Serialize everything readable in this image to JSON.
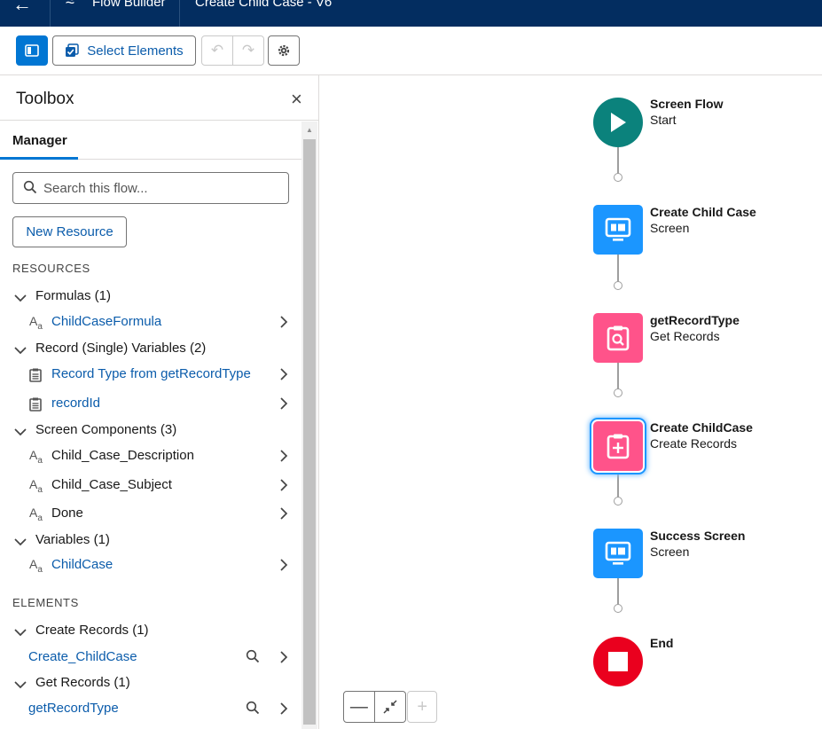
{
  "header": {
    "app_name": "Flow Builder",
    "flow_name": "Create Child Case - V6"
  },
  "toolbar": {
    "select_elements_label": "Select Elements"
  },
  "toolbox": {
    "title": "Toolbox",
    "tab_manager": "Manager",
    "search_placeholder": "Search this flow...",
    "new_resource_label": "New Resource",
    "resources_label": "RESOURCES",
    "elements_label": "ELEMENTS",
    "groups": {
      "formulas": "Formulas (1)",
      "record_single": "Record (Single) Variables (2)",
      "screen_components": "Screen Components (3)",
      "variables": "Variables (1)",
      "create_records": "Create Records (1)",
      "get_records": "Get Records (1)"
    },
    "items": {
      "child_case_formula": "ChildCaseFormula",
      "record_type_from": "Record Type from getRecordType",
      "record_id": "recordId",
      "child_case_description": "Child_Case_Description",
      "child_case_subject": "Child_Case_Subject",
      "done": "Done",
      "child_case": "ChildCase",
      "create_childcase_el": "Create_ChildCase",
      "get_record_type_el": "getRecordType"
    }
  },
  "flow": {
    "nodes": [
      {
        "title": "Screen Flow",
        "subtitle": "Start",
        "color": "#0b827c",
        "icon": "play-icon"
      },
      {
        "title": "Create Child Case",
        "subtitle": "Screen",
        "color": "#1b96ff",
        "icon": "screen-icon"
      },
      {
        "title": "getRecordType",
        "subtitle": "Get Records",
        "color": "#ff538a",
        "icon": "record-lookup-icon"
      },
      {
        "title": "Create ChildCase",
        "subtitle": "Create Records",
        "color": "#ff538a",
        "icon": "record-create-icon"
      },
      {
        "title": "Success Screen",
        "subtitle": "Screen",
        "color": "#1b96ff",
        "icon": "screen-icon"
      },
      {
        "title": "End",
        "subtitle": "",
        "color": "#ea001e",
        "icon": "stop-icon"
      }
    ]
  }
}
